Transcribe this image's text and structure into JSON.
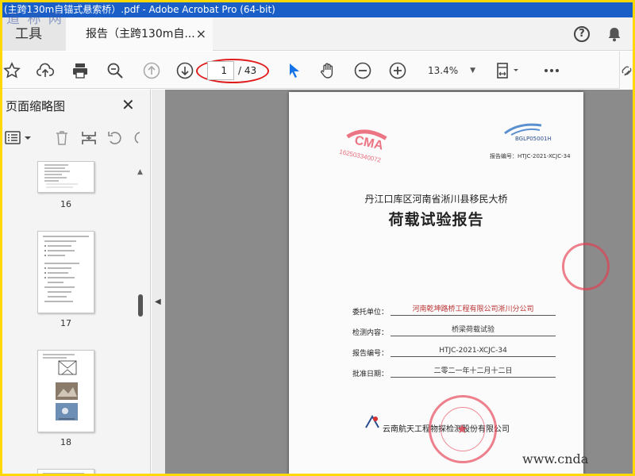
{
  "window": {
    "title": "(主跨130m自锚式悬索桥）.pdf - Adobe Acrobat Pro (64-bit)",
    "watermark_top_left": "道 称 网"
  },
  "tabs": {
    "tools_label": "工具",
    "doc_label": "报告（主跨130m自...",
    "close_glyph": "×"
  },
  "toolbar": {
    "icons": [
      "bookmark-star-icon",
      "cloud-upload-icon",
      "print-icon",
      "zoom-search-icon",
      "page-up-icon",
      "page-down-icon",
      "select-cursor-icon",
      "hand-icon",
      "zoom-out-icon",
      "zoom-in-icon",
      "fit-page-icon",
      "more-icon"
    ],
    "current_page": "1",
    "total_pages": "/ 43",
    "zoom": "13.4%",
    "highlight_color": "#e01b1b",
    "cursor_color": "#1473e6"
  },
  "panel": {
    "title": "页面缩略图",
    "close_glyph": "✕",
    "thumbnails": [
      {
        "page": "16"
      },
      {
        "page": "17"
      },
      {
        "page": "18"
      }
    ]
  },
  "document": {
    "top_code": "BGLP05001H",
    "report_no_top": "报告编号：HTJC-2021-XCJC-34",
    "subtitle": "丹江口库区河南省淅川县移民大桥",
    "title": "荷载试验报告",
    "fields": [
      {
        "label": "委托单位：",
        "value": "河南乾坤路桥工程有限公司淅川分公司"
      },
      {
        "label": "检测内容：",
        "value": "桥梁荷载试验"
      },
      {
        "label": "报告编号：",
        "value": "HTJC-2021-XCJC-34"
      },
      {
        "label": "批准日期：",
        "value": "二零二一年十二月十二日"
      }
    ],
    "company": "云南航天工程物探检测股份有限公司",
    "stamp_text": "162503340072",
    "stamp_color": "#e63c50"
  },
  "watermark_bottom_right": "www.cnda"
}
